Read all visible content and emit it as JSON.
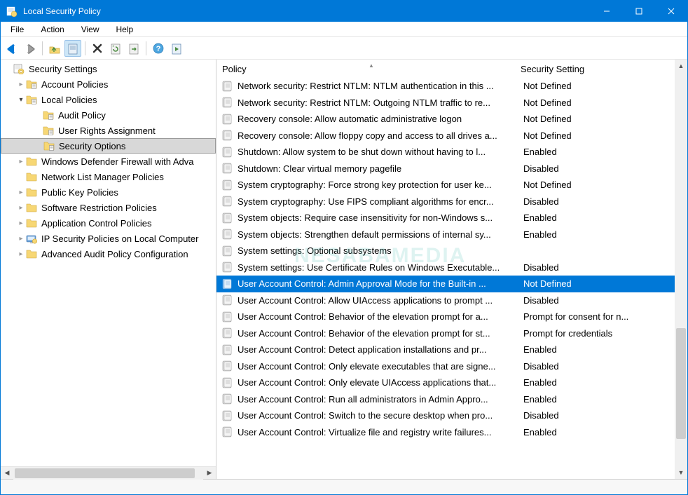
{
  "window": {
    "title": "Local Security Policy"
  },
  "menu": [
    "File",
    "Action",
    "View",
    "Help"
  ],
  "toolbar": {
    "back": "back",
    "forward": "forward",
    "up": "up",
    "properties": "properties",
    "delete": "delete",
    "refresh": "refresh",
    "export": "export",
    "help": "help",
    "run": "run"
  },
  "tree": [
    {
      "depth": 0,
      "expander": "none",
      "icon": "policy-root",
      "label": "Security Settings",
      "selected": false
    },
    {
      "depth": 1,
      "expander": "closed",
      "icon": "folder-policy",
      "label": "Account Policies",
      "selected": false
    },
    {
      "depth": 1,
      "expander": "open",
      "icon": "folder-policy",
      "label": "Local Policies",
      "selected": false
    },
    {
      "depth": 2,
      "expander": "none",
      "icon": "folder-policy",
      "label": "Audit Policy",
      "selected": false
    },
    {
      "depth": 2,
      "expander": "none",
      "icon": "folder-policy",
      "label": "User Rights Assignment",
      "selected": false
    },
    {
      "depth": 2,
      "expander": "none",
      "icon": "folder-policy",
      "label": "Security Options",
      "selected": true
    },
    {
      "depth": 1,
      "expander": "closed",
      "icon": "folder",
      "label": "Windows Defender Firewall with Adva",
      "selected": false
    },
    {
      "depth": 1,
      "expander": "none",
      "icon": "folder",
      "label": "Network List Manager Policies",
      "selected": false
    },
    {
      "depth": 1,
      "expander": "closed",
      "icon": "folder",
      "label": "Public Key Policies",
      "selected": false
    },
    {
      "depth": 1,
      "expander": "closed",
      "icon": "folder",
      "label": "Software Restriction Policies",
      "selected": false
    },
    {
      "depth": 1,
      "expander": "closed",
      "icon": "folder",
      "label": "Application Control Policies",
      "selected": false
    },
    {
      "depth": 1,
      "expander": "closed",
      "icon": "ipsec",
      "label": "IP Security Policies on Local Computer",
      "selected": false
    },
    {
      "depth": 1,
      "expander": "closed",
      "icon": "folder",
      "label": "Advanced Audit Policy Configuration",
      "selected": false
    }
  ],
  "columns": {
    "policy": "Policy",
    "setting": "Security Setting"
  },
  "policies": [
    {
      "name": "Network security: Restrict NTLM: NTLM authentication in this ...",
      "value": "Not Defined",
      "selected": false
    },
    {
      "name": "Network security: Restrict NTLM: Outgoing NTLM traffic to re...",
      "value": "Not Defined",
      "selected": false
    },
    {
      "name": "Recovery console: Allow automatic administrative logon",
      "value": "Not Defined",
      "selected": false
    },
    {
      "name": "Recovery console: Allow floppy copy and access to all drives a...",
      "value": "Not Defined",
      "selected": false
    },
    {
      "name": "Shutdown: Allow system to be shut down without having to l...",
      "value": "Enabled",
      "selected": false
    },
    {
      "name": "Shutdown: Clear virtual memory pagefile",
      "value": "Disabled",
      "selected": false
    },
    {
      "name": "System cryptography: Force strong key protection for user ke...",
      "value": "Not Defined",
      "selected": false
    },
    {
      "name": "System cryptography: Use FIPS compliant algorithms for encr...",
      "value": "Disabled",
      "selected": false
    },
    {
      "name": "System objects: Require case insensitivity for non-Windows s...",
      "value": "Enabled",
      "selected": false
    },
    {
      "name": "System objects: Strengthen default permissions of internal sy...",
      "value": "Enabled",
      "selected": false
    },
    {
      "name": "System settings: Optional subsystems",
      "value": "",
      "selected": false
    },
    {
      "name": "System settings: Use Certificate Rules on Windows Executable...",
      "value": "Disabled",
      "selected": false
    },
    {
      "name": "User Account Control: Admin Approval Mode for the Built-in ...",
      "value": "Not Defined",
      "selected": true
    },
    {
      "name": "User Account Control: Allow UIAccess applications to prompt ...",
      "value": "Disabled",
      "selected": false
    },
    {
      "name": "User Account Control: Behavior of the elevation prompt for a...",
      "value": "Prompt for consent for n...",
      "selected": false
    },
    {
      "name": "User Account Control: Behavior of the elevation prompt for st...",
      "value": "Prompt for credentials",
      "selected": false
    },
    {
      "name": "User Account Control: Detect application installations and pr...",
      "value": "Enabled",
      "selected": false
    },
    {
      "name": "User Account Control: Only elevate executables that are signe...",
      "value": "Disabled",
      "selected": false
    },
    {
      "name": "User Account Control: Only elevate UIAccess applications that...",
      "value": "Enabled",
      "selected": false
    },
    {
      "name": "User Account Control: Run all administrators in Admin Appro...",
      "value": "Enabled",
      "selected": false
    },
    {
      "name": "User Account Control: Switch to the secure desktop when pro...",
      "value": "Disabled",
      "selected": false
    },
    {
      "name": "User Account Control: Virtualize file and registry write failures...",
      "value": "Enabled",
      "selected": false
    }
  ],
  "watermark": "NESABAMEDIA"
}
